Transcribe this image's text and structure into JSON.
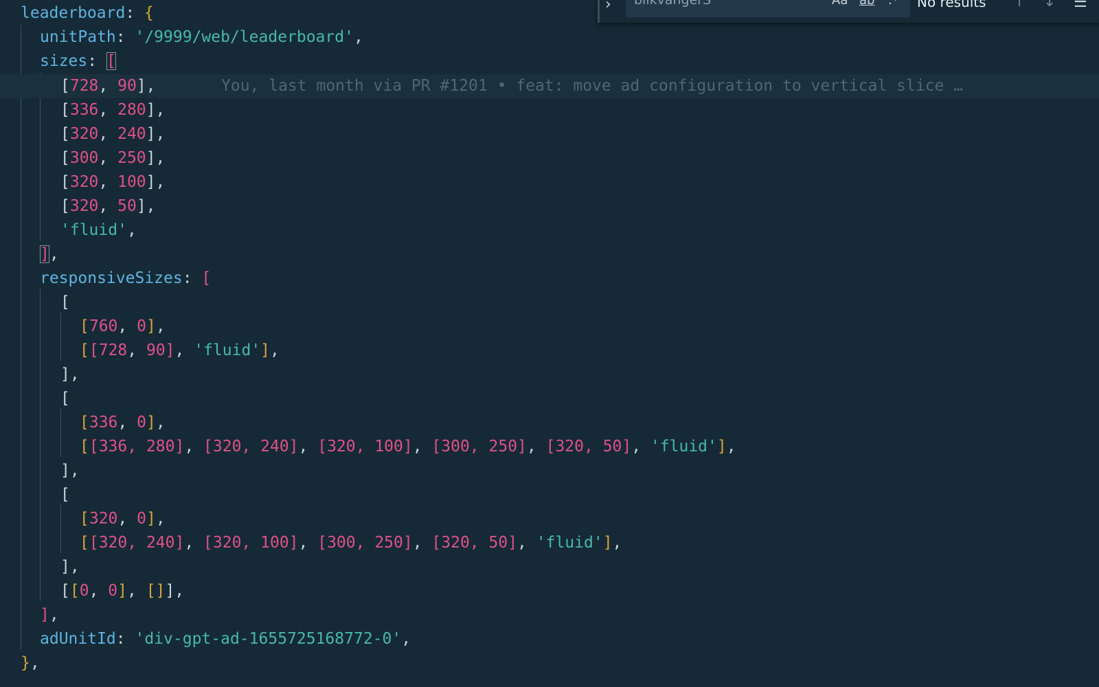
{
  "code": {
    "l1": {
      "key": "leaderboard",
      "colon": ": ",
      "brace": "{"
    },
    "l2": {
      "key": "unitPath",
      "colon": ": ",
      "str": "'/9999/web/leaderboard'",
      "comma": ","
    },
    "l3": {
      "key": "sizes",
      "colon": ": ",
      "open": "["
    },
    "l4": {
      "open": "[",
      "a": "728",
      "sep": ", ",
      "b": "90",
      "close": "],"
    },
    "l5": {
      "open": "[",
      "a": "336",
      "sep": ", ",
      "b": "280",
      "close": "],"
    },
    "l6": {
      "open": "[",
      "a": "320",
      "sep": ", ",
      "b": "240",
      "close": "],"
    },
    "l7": {
      "open": "[",
      "a": "300",
      "sep": ", ",
      "b": "250",
      "close": "],"
    },
    "l8": {
      "open": "[",
      "a": "320",
      "sep": ", ",
      "b": "100",
      "close": "],"
    },
    "l9": {
      "open": "[",
      "a": "320",
      "sep": ", ",
      "b": "50",
      "close": "],"
    },
    "l10": {
      "str": "'fluid'",
      "comma": ","
    },
    "l11": {
      "close": "]",
      "comma": ","
    },
    "l12": {
      "key": "responsiveSizes",
      "colon": ": ",
      "open": "["
    },
    "l13": {
      "open": "["
    },
    "l14": {
      "open": "[",
      "a": "760",
      "sep": ", ",
      "b": "0",
      "close": "]",
      "comma": ","
    },
    "l15": {
      "outer": "[",
      "open": "[",
      "a": "728",
      "sep": ", ",
      "b": "90",
      "close": "]",
      "sep2": ", ",
      "str": "'fluid'",
      "outerclose": "]",
      "comma": ","
    },
    "l16": {
      "close": "],"
    },
    "l17": {
      "open": "["
    },
    "l18": {
      "open": "[",
      "a": "336",
      "sep": ", ",
      "b": "0",
      "close": "]",
      "comma": ","
    },
    "l19": {
      "text_pre": "[",
      "pairs": [
        "[336, 280]",
        "[320, 240]",
        "[320, 100]",
        "[300, 250]",
        "[320, 50]"
      ],
      "str": "'fluid'",
      "text_post": "]",
      "comma": ","
    },
    "l20": {
      "close": "],"
    },
    "l21": {
      "open": "["
    },
    "l22": {
      "open": "[",
      "a": "320",
      "sep": ", ",
      "b": "0",
      "close": "]",
      "comma": ","
    },
    "l23": {
      "text_pre": "[",
      "pairs": [
        "[320, 240]",
        "[320, 100]",
        "[300, 250]",
        "[320, 50]"
      ],
      "str": "'fluid'",
      "text_post": "]",
      "comma": ","
    },
    "l24": {
      "close": "],"
    },
    "l25": {
      "outer": "[",
      "open": "[",
      "a": "0",
      "sep": ", ",
      "b": "0",
      "close": "]",
      "sep2": ", ",
      "empty": "[]",
      "outerclose": "]",
      "comma": ","
    },
    "l26": {
      "close": "]",
      "comma": ","
    },
    "l27": {
      "key": "adUnitId",
      "colon": ": ",
      "str": "'div-gpt-ad-1655725168772-0'",
      "comma": ","
    },
    "l28": {
      "brace": "}",
      "comma": ","
    }
  },
  "blame": "You, last month via PR #1201 • feat: move ad configuration to vertical slice …",
  "find": {
    "toggle": "›",
    "query": "blikvangerS",
    "match_case": "Aa",
    "whole_word": "ab",
    "regex": ".*",
    "results": "No results",
    "prev": "↑",
    "next": "↓",
    "menu": "☰"
  }
}
